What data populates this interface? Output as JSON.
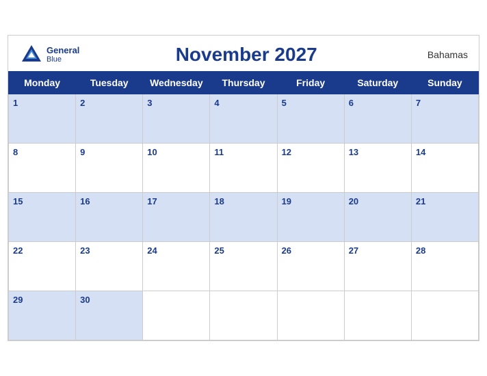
{
  "header": {
    "title": "November 2027",
    "country": "Bahamas",
    "logo_top": "General",
    "logo_bottom": "Blue"
  },
  "days_of_week": [
    "Monday",
    "Tuesday",
    "Wednesday",
    "Thursday",
    "Friday",
    "Saturday",
    "Sunday"
  ],
  "weeks": [
    [
      {
        "num": "1"
      },
      {
        "num": "2"
      },
      {
        "num": "3"
      },
      {
        "num": "4"
      },
      {
        "num": "5"
      },
      {
        "num": "6"
      },
      {
        "num": "7"
      }
    ],
    [
      {
        "num": "8"
      },
      {
        "num": "9"
      },
      {
        "num": "10"
      },
      {
        "num": "11"
      },
      {
        "num": "12"
      },
      {
        "num": "13"
      },
      {
        "num": "14"
      }
    ],
    [
      {
        "num": "15"
      },
      {
        "num": "16"
      },
      {
        "num": "17"
      },
      {
        "num": "18"
      },
      {
        "num": "19"
      },
      {
        "num": "20"
      },
      {
        "num": "21"
      }
    ],
    [
      {
        "num": "22"
      },
      {
        "num": "23"
      },
      {
        "num": "24"
      },
      {
        "num": "25"
      },
      {
        "num": "26"
      },
      {
        "num": "27"
      },
      {
        "num": "28"
      }
    ],
    [
      {
        "num": "29"
      },
      {
        "num": "30"
      },
      {
        "num": ""
      },
      {
        "num": ""
      },
      {
        "num": ""
      },
      {
        "num": ""
      },
      {
        "num": ""
      }
    ]
  ]
}
